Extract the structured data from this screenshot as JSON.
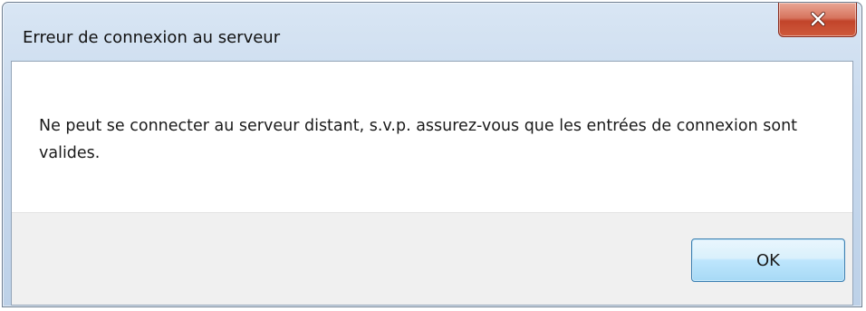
{
  "dialog": {
    "title": "Erreur de connexion au serveur",
    "message": "Ne peut se connecter au serveur distant, s.v.p. assurez-vous que les entrées de connexion sont valides.",
    "ok_label": "OK",
    "close_icon": "close-icon"
  },
  "colors": {
    "close_button": "#c2442a",
    "ok_button_border": "#3c7fb1",
    "title_bar": "#c9daee",
    "button_bar": "#f0f0f0"
  }
}
